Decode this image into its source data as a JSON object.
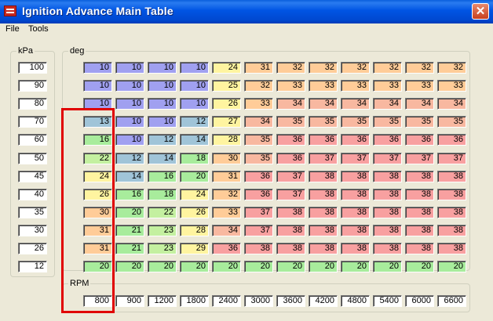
{
  "window": {
    "title": "Ignition Advance Main Table",
    "close_glyph": "✕"
  },
  "menu": [
    "File",
    "Tools"
  ],
  "kpa": {
    "label": "kPa",
    "values": [
      "100",
      "90",
      "80",
      "70",
      "60",
      "50",
      "45",
      "40",
      "35",
      "30",
      "26",
      "12"
    ]
  },
  "deg": {
    "label": "deg",
    "rows": [
      [
        "10",
        "10",
        "10",
        "10",
        "24",
        "31",
        "32",
        "32",
        "32",
        "32",
        "32",
        "32"
      ],
      [
        "10",
        "10",
        "10",
        "10",
        "25",
        "32",
        "33",
        "33",
        "33",
        "33",
        "33",
        "33"
      ],
      [
        "10",
        "10",
        "10",
        "10",
        "26",
        "33",
        "34",
        "34",
        "34",
        "34",
        "34",
        "34"
      ],
      [
        "13",
        "10",
        "10",
        "12",
        "27",
        "34",
        "35",
        "35",
        "35",
        "35",
        "35",
        "35"
      ],
      [
        "16",
        "10",
        "12",
        "14",
        "28",
        "35",
        "36",
        "36",
        "36",
        "36",
        "36",
        "36"
      ],
      [
        "22",
        "12",
        "14",
        "18",
        "30",
        "35",
        "36",
        "37",
        "37",
        "37",
        "37",
        "37"
      ],
      [
        "24",
        "14",
        "16",
        "20",
        "31",
        "36",
        "37",
        "38",
        "38",
        "38",
        "38",
        "38"
      ],
      [
        "26",
        "16",
        "18",
        "24",
        "32",
        "36",
        "37",
        "38",
        "38",
        "38",
        "38",
        "38"
      ],
      [
        "30",
        "20",
        "22",
        "26",
        "33",
        "37",
        "38",
        "38",
        "38",
        "38",
        "38",
        "38"
      ],
      [
        "31",
        "21",
        "23",
        "28",
        "34",
        "37",
        "38",
        "38",
        "38",
        "38",
        "38",
        "38"
      ],
      [
        "31",
        "21",
        "23",
        "29",
        "36",
        "38",
        "38",
        "38",
        "38",
        "38",
        "38",
        "38"
      ],
      [
        "20",
        "20",
        "20",
        "20",
        "20",
        "20",
        "20",
        "20",
        "20",
        "20",
        "20",
        "20"
      ]
    ]
  },
  "rpm": {
    "label": "RPM",
    "values": [
      "800",
      "900",
      "1200",
      "1800",
      "2400",
      "3000",
      "3600",
      "4200",
      "4800",
      "5400",
      "6000",
      "6600"
    ]
  },
  "colors": {
    "highlight_box": "#e00000",
    "title_bar": "#0054e3"
  }
}
